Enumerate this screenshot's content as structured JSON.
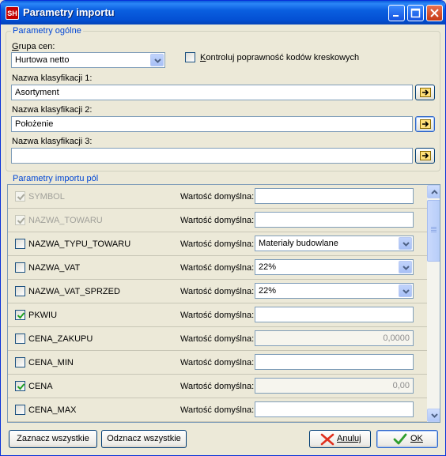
{
  "window": {
    "title": "Parametry importu",
    "app_icon_text": "SH"
  },
  "general": {
    "legend": "Parametry ogólne",
    "price_group_label": "Grupa cen:",
    "price_group_value": "Hurtowa netto",
    "barcode_check_label": "Kontroluj poprawność kodów kreskowych",
    "barcode_check_checked": false,
    "class1_label": "Nazwa klasyfikacji 1:",
    "class1_value": "Asortyment",
    "class2_label": "Nazwa klasyfikacji 2:",
    "class2_value": "Położenie",
    "class3_label": "Nazwa klasyfikacji 3:",
    "class3_value": ""
  },
  "fields": {
    "legend": "Parametry importu pól",
    "default_label": "Wartość domyślna:",
    "rows": [
      {
        "name": "SYMBOL",
        "checked": true,
        "disabled": true,
        "type": "text",
        "value": ""
      },
      {
        "name": "NAZWA_TOWARU",
        "checked": true,
        "disabled": true,
        "type": "text",
        "value": ""
      },
      {
        "name": "NAZWA_TYPU_TOWARU",
        "checked": false,
        "disabled": false,
        "type": "combo",
        "value": "Materiały budowlane"
      },
      {
        "name": "NAZWA_VAT",
        "checked": false,
        "disabled": false,
        "type": "combo",
        "value": "22%"
      },
      {
        "name": "NAZWA_VAT_SPRZED",
        "checked": false,
        "disabled": false,
        "type": "combo",
        "value": "22%"
      },
      {
        "name": "PKWIU",
        "checked": true,
        "disabled": false,
        "type": "text",
        "value": ""
      },
      {
        "name": "CENA_ZAKUPU",
        "checked": false,
        "disabled": false,
        "type": "readonly",
        "value": "0,0000"
      },
      {
        "name": "CENA_MIN",
        "checked": false,
        "disabled": false,
        "type": "text",
        "value": ""
      },
      {
        "name": "CENA",
        "checked": true,
        "disabled": false,
        "type": "readonly",
        "value": "0,00"
      },
      {
        "name": "CENA_MAX",
        "checked": false,
        "disabled": false,
        "type": "text",
        "value": ""
      }
    ]
  },
  "buttons": {
    "select_all": "Zaznacz wszystkie",
    "deselect_all": "Odznacz wszystkie",
    "cancel": "Anuluj",
    "ok": "OK"
  },
  "colors": {
    "accent": "#0046d5",
    "title_bar": "#0a5ddb",
    "cancel_icon": "#e0301e",
    "ok_icon": "#2e9e2e"
  }
}
